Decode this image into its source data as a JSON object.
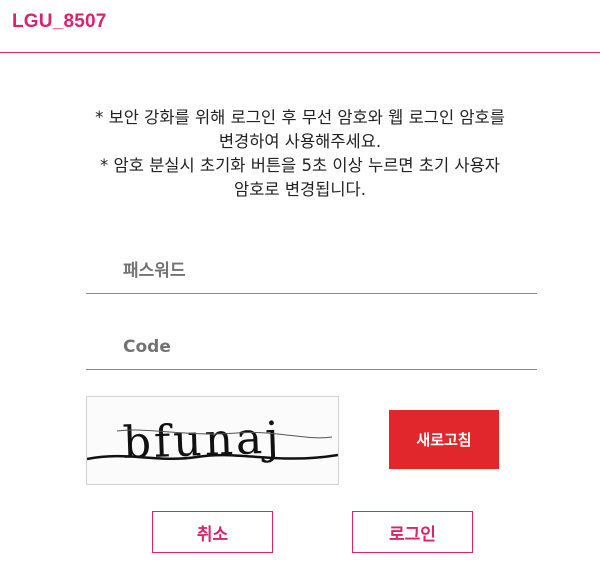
{
  "header": {
    "title": "LGU_8507"
  },
  "notice": {
    "lines": [
      "* 보안 강화를 위해 로그인 후 무선 암호와 웹 로그인 암호를",
      "변경하여 사용해주세요.",
      "* 암호 분실시 초기화 버튼을 5초 이상 누르면 초기 사용자",
      "암호로 변경됩니다."
    ]
  },
  "form": {
    "password_placeholder": "패스워드",
    "code_placeholder": "Code"
  },
  "captcha": {
    "text": "bfunaj"
  },
  "buttons": {
    "refresh": "새로고침",
    "cancel": "취소",
    "login": "로그인"
  },
  "colors": {
    "accent": "#d6246e",
    "refresh_bg": "#e2272c"
  }
}
